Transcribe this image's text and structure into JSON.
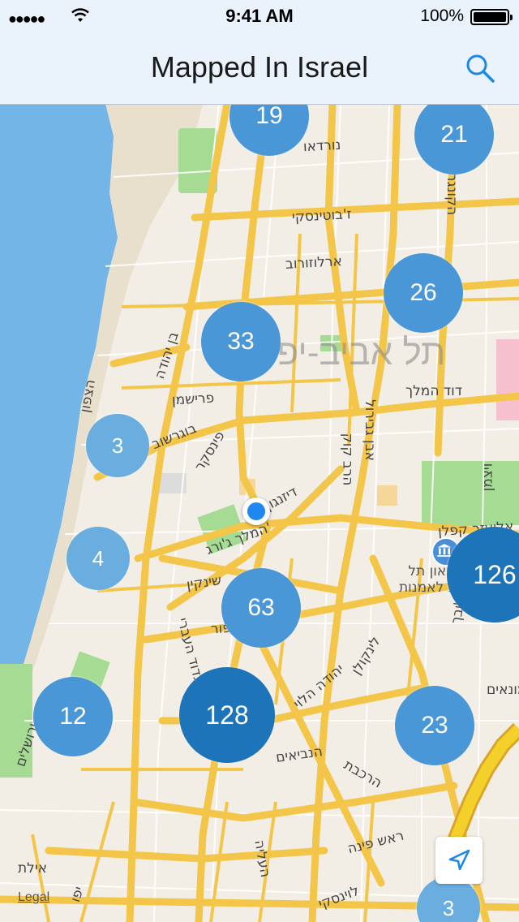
{
  "status_bar": {
    "signal": "●●●●●",
    "time": "9:41 AM",
    "battery": "100%"
  },
  "nav": {
    "title": "Mapped In Israel",
    "search_icon": "search-icon"
  },
  "map": {
    "city_label": "תל אביב-יפו",
    "streets": [
      {
        "name": "נורדאו"
      },
      {
        "name": "ז'בוטינסקי"
      },
      {
        "name": "ארלוזורוב"
      },
      {
        "name": "בן יהודה"
      },
      {
        "name": "דוד המלך"
      },
      {
        "name": "פרישמן"
      },
      {
        "name": "בוגרשוב"
      },
      {
        "name": "פינסקר"
      },
      {
        "name": "הצפון"
      },
      {
        "name": "הרב קוק"
      },
      {
        "name": "דיזנגוף"
      },
      {
        "name": "המלך ג'ורג'"
      },
      {
        "name": "אליעזר קפלן"
      },
      {
        "name": "ויצמן"
      },
      {
        "name": "אבן גבירול"
      },
      {
        "name": "בלפור"
      },
      {
        "name": "שינקין"
      },
      {
        "name": "לינקולן"
      },
      {
        "name": "יהודה הלוי"
      },
      {
        "name": "החשמונאים"
      },
      {
        "name": "קרליבך"
      },
      {
        "name": "הרכבת"
      },
      {
        "name": "הנביאים"
      },
      {
        "name": "ראש פינה"
      },
      {
        "name": "העליה"
      },
      {
        "name": "לוינסקי"
      },
      {
        "name": "אילת"
      },
      {
        "name": "יפו"
      },
      {
        "name": "הגדוד העברי"
      },
      {
        "name": "הקונגרס"
      },
      {
        "name": "ירושלים"
      }
    ],
    "museum_label_line1": "מוזיאון תל",
    "museum_label_line2": "אביב לאמנות",
    "clusters": [
      {
        "count": "19",
        "color": "#4a97d8"
      },
      {
        "count": "21",
        "color": "#4a97d8"
      },
      {
        "count": "26",
        "color": "#4a97d8"
      },
      {
        "count": "33",
        "color": "#4a97d8"
      },
      {
        "count": "3",
        "color": "#6aaee0"
      },
      {
        "count": "4",
        "color": "#6aaee0"
      },
      {
        "count": "126",
        "color": "#1e74b8"
      },
      {
        "count": "63",
        "color": "#4a97d8"
      },
      {
        "count": "12",
        "color": "#4a97d8"
      },
      {
        "count": "128",
        "color": "#1e74b8"
      },
      {
        "count": "23",
        "color": "#4a97d8"
      },
      {
        "count": "3",
        "color": "#6aaee0"
      }
    ],
    "legal": "Legal",
    "location_button_icon": "location-arrow-icon"
  }
}
